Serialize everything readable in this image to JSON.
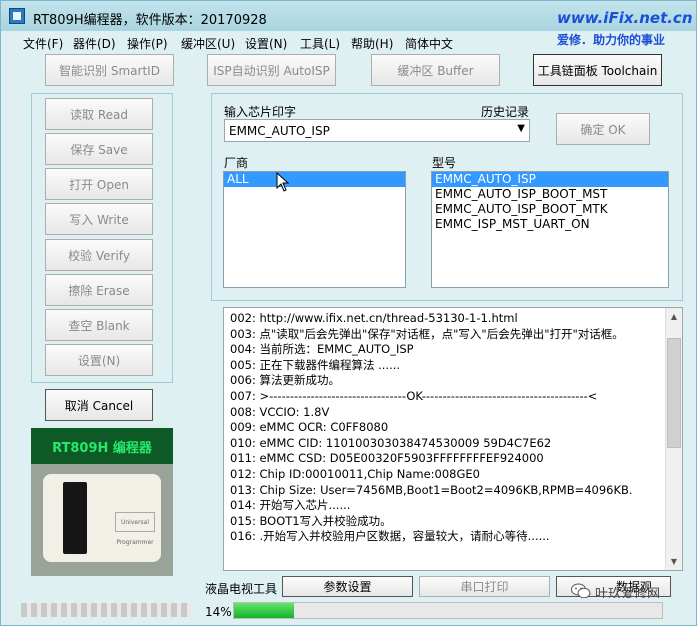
{
  "window": {
    "title": "RT809H编程器，软件版本：20170928",
    "brand_line1": "www.iFix.net.cn",
    "brand_line2": "爱修．助力你的事业"
  },
  "menu": [
    "文件(F)",
    "器件(D)",
    "操作(P)",
    "缓冲区(U)",
    "设置(N)",
    "工具(L)",
    "帮助(H)",
    "简体中文"
  ],
  "toolbar": {
    "smartid": "智能识别 SmartID",
    "autoisp": "ISP自动识别 AutoISP",
    "buffer": "缓冲区 Buffer",
    "toolchain": "工具链面板 Toolchain"
  },
  "side_buttons": [
    "读取 Read",
    "保存 Save",
    "打开 Open",
    "写入 Write",
    "校验 Verify",
    "擦除 Erase",
    "查空 Blank",
    "设置(N)"
  ],
  "cancel_label": "取消 Cancel",
  "chip": {
    "input_label": "输入芯片印字",
    "history_label": "历史记录",
    "value": "EMMC_AUTO_ISP",
    "ok_label": "确定 OK",
    "vendor_label": "厂商",
    "model_label": "型号",
    "vendors": [
      "ALL"
    ],
    "models": [
      "EMMC_AUTO_ISP",
      "EMMC_AUTO_ISP_BOOT_MST",
      "EMMC_AUTO_ISP_BOOT_MTK",
      "EMMC_ISP_MST_UART_ON"
    ]
  },
  "log": [
    "002:  http://www.ifix.net.cn/thread-53130-1-1.html",
    "003:  点\"读取\"后会先弹出\"保存\"对话框，点\"写入\"后会先弹出\"打开\"对话框。",
    "004:  当前所选：EMMC_AUTO_ISP",
    "005:  正在下载器件编程算法 ......",
    "006:  算法更新成功。",
    "007:  >---------------------------------OK----------------------------------------<",
    "008:  VCCIO: 1.8V",
    "009:    eMMC OCR: C0FF8080",
    "010:  eMMC CID:   110100303038474530009 59D4C7E62",
    "011:  eMMC CSD:  D05E00320F5903FFFFFFFFEF924000",
    "012:  Chip ID:00010011,Chip Name:008GE0",
    "013:  Chip Size: User=7456MB,Boot1=Boot2=4096KB,RPMB=4096KB.",
    "014:  开始写入芯片......",
    "015:  BOOT1写入并校验成功。",
    "016:  .开始写入并校验用户区数据，容量较大，请耐心等待......"
  ],
  "product": {
    "banner": "RT809H 编程器",
    "device_label": "Universal Programmer"
  },
  "bottom": {
    "lcd_tool": "液晶电视工具",
    "param_button": "参数设置",
    "serial_button": "串口打印",
    "data_button": "数据观"
  },
  "progress": {
    "text": "14%",
    "value": 14
  },
  "watermark": "叶玖爱修网"
}
